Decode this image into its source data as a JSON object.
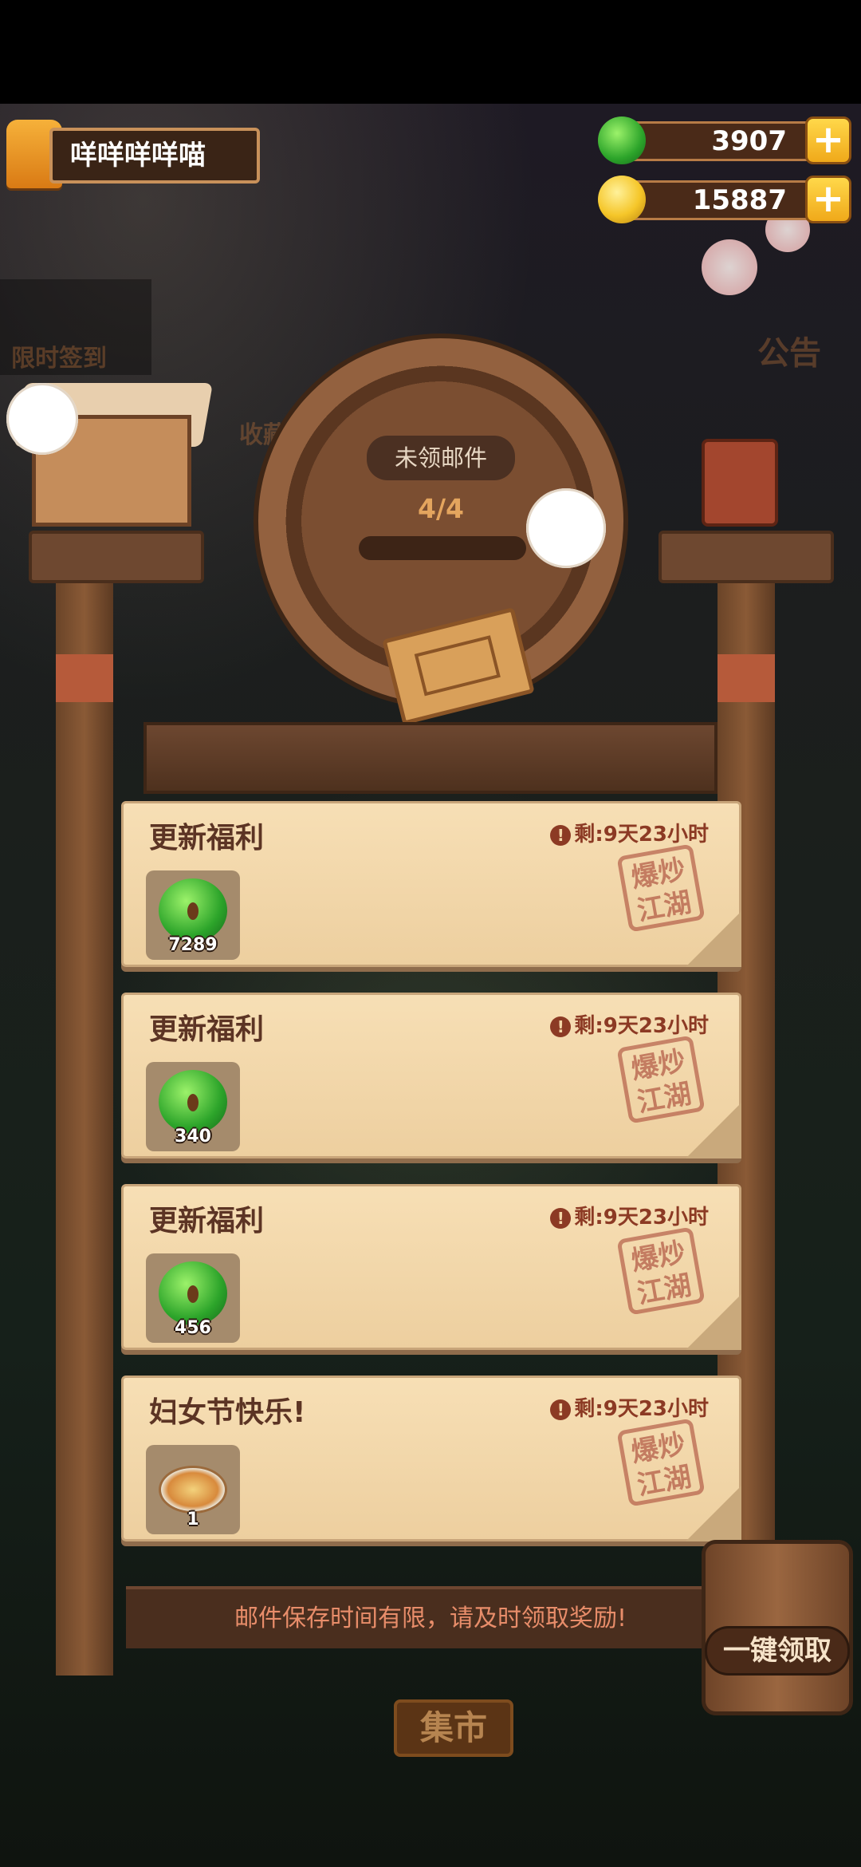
{
  "player": {
    "name": "咩咩咩咩喵"
  },
  "currency": {
    "jade": "3907",
    "coins": "15887"
  },
  "background": {
    "left_labels": [
      "限时签到",
      "收藏"
    ],
    "right_labels": [
      "公告"
    ],
    "market_label": "集市"
  },
  "mailbox": {
    "header_label": "未领邮件",
    "count": "4/4"
  },
  "mails": [
    {
      "title": "更新福利",
      "timer": "剩:9天23小时",
      "item": "jade",
      "qty": "7289",
      "stamp": "爆炒江湖"
    },
    {
      "title": "更新福利",
      "timer": "剩:9天23小时",
      "item": "jade",
      "qty": "340",
      "stamp": "爆炒江湖"
    },
    {
      "title": "更新福利",
      "timer": "剩:9天23小时",
      "item": "jade",
      "qty": "456",
      "stamp": "爆炒江湖"
    },
    {
      "title": "妇女节快乐!",
      "timer": "剩:9天23小时",
      "item": "food",
      "qty": "1",
      "stamp": "爆炒江湖"
    }
  ],
  "footer": {
    "notice": "邮件保存时间有限，请及时领取奖励!",
    "claim_all": "一键领取"
  },
  "colors": {
    "accent_gold": "#f0a91a",
    "jade_green": "#2ca42a",
    "paper": "#f7dfb5",
    "wood": "#6e4830"
  }
}
